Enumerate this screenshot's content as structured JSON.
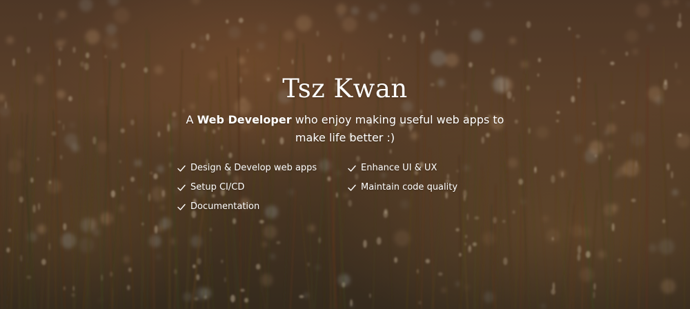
{
  "profile": {
    "name": "Tsz Kwan",
    "tagline_prefix": "A ",
    "tagline_role": "Web Developer",
    "tagline_suffix": " who enjoy making useful web apps to make life better :)"
  },
  "skills": [
    {
      "label": "Design & Develop web apps",
      "icon": "check-icon"
    },
    {
      "label": "Enhance UI & UX",
      "icon": "check-icon"
    },
    {
      "label": "Setup CI/CD",
      "icon": "check-icon"
    },
    {
      "label": "Maintain code quality",
      "icon": "check-icon"
    },
    {
      "label": "Documentation",
      "icon": "check-icon"
    }
  ],
  "colors": {
    "text": "#ffffff",
    "background_tone": "#5a3f2d"
  }
}
